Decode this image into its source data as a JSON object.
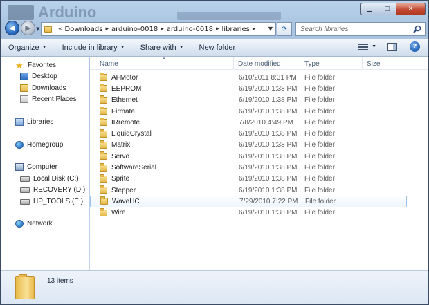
{
  "window": {
    "bg_title": "Arduino",
    "caption": {
      "minimize": "▁",
      "maximize": "▢",
      "close": "✕"
    }
  },
  "address": {
    "prefix": "«",
    "crumbs": [
      "Downloads",
      "arduino-0018",
      "arduino-0018",
      "libraries"
    ]
  },
  "search": {
    "placeholder": "Search libraries"
  },
  "toolbar": {
    "organize": "Organize",
    "include_in_library": "Include in library",
    "share_with": "Share with",
    "new_folder": "New folder"
  },
  "navpane": {
    "favorites": "Favorites",
    "desktop": "Desktop",
    "downloads": "Downloads",
    "recent_places": "Recent Places",
    "libraries": "Libraries",
    "homegroup": "Homegroup",
    "computer": "Computer",
    "local_disk": "Local Disk (C:)",
    "recovery": "RECOVERY (D:)",
    "hp_tools": "HP_TOOLS (E:)",
    "network": "Network"
  },
  "columns": {
    "name": "Name",
    "date": "Date modified",
    "type": "Type",
    "size": "Size"
  },
  "files": [
    {
      "name": "AFMotor",
      "date": "6/10/2011 8:31 PM",
      "type": "File folder"
    },
    {
      "name": "EEPROM",
      "date": "6/19/2010 1:38 PM",
      "type": "File folder"
    },
    {
      "name": "Ethernet",
      "date": "6/19/2010 1:38 PM",
      "type": "File folder"
    },
    {
      "name": "Firmata",
      "date": "6/19/2010 1:38 PM",
      "type": "File folder"
    },
    {
      "name": "IRremote",
      "date": "7/8/2010 4:49 PM",
      "type": "File folder"
    },
    {
      "name": "LiquidCrystal",
      "date": "6/19/2010 1:38 PM",
      "type": "File folder"
    },
    {
      "name": "Matrix",
      "date": "6/19/2010 1:38 PM",
      "type": "File folder"
    },
    {
      "name": "Servo",
      "date": "6/19/2010 1:38 PM",
      "type": "File folder"
    },
    {
      "name": "SoftwareSerial",
      "date": "6/19/2010 1:38 PM",
      "type": "File folder"
    },
    {
      "name": "Sprite",
      "date": "6/19/2010 1:38 PM",
      "type": "File folder"
    },
    {
      "name": "Stepper",
      "date": "6/19/2010 1:38 PM",
      "type": "File folder"
    },
    {
      "name": "WaveHC",
      "date": "7/29/2010 7:22 PM",
      "type": "File folder"
    },
    {
      "name": "Wire",
      "date": "6/19/2010 1:38 PM",
      "type": "File folder"
    }
  ],
  "status": {
    "items": "13 items"
  }
}
